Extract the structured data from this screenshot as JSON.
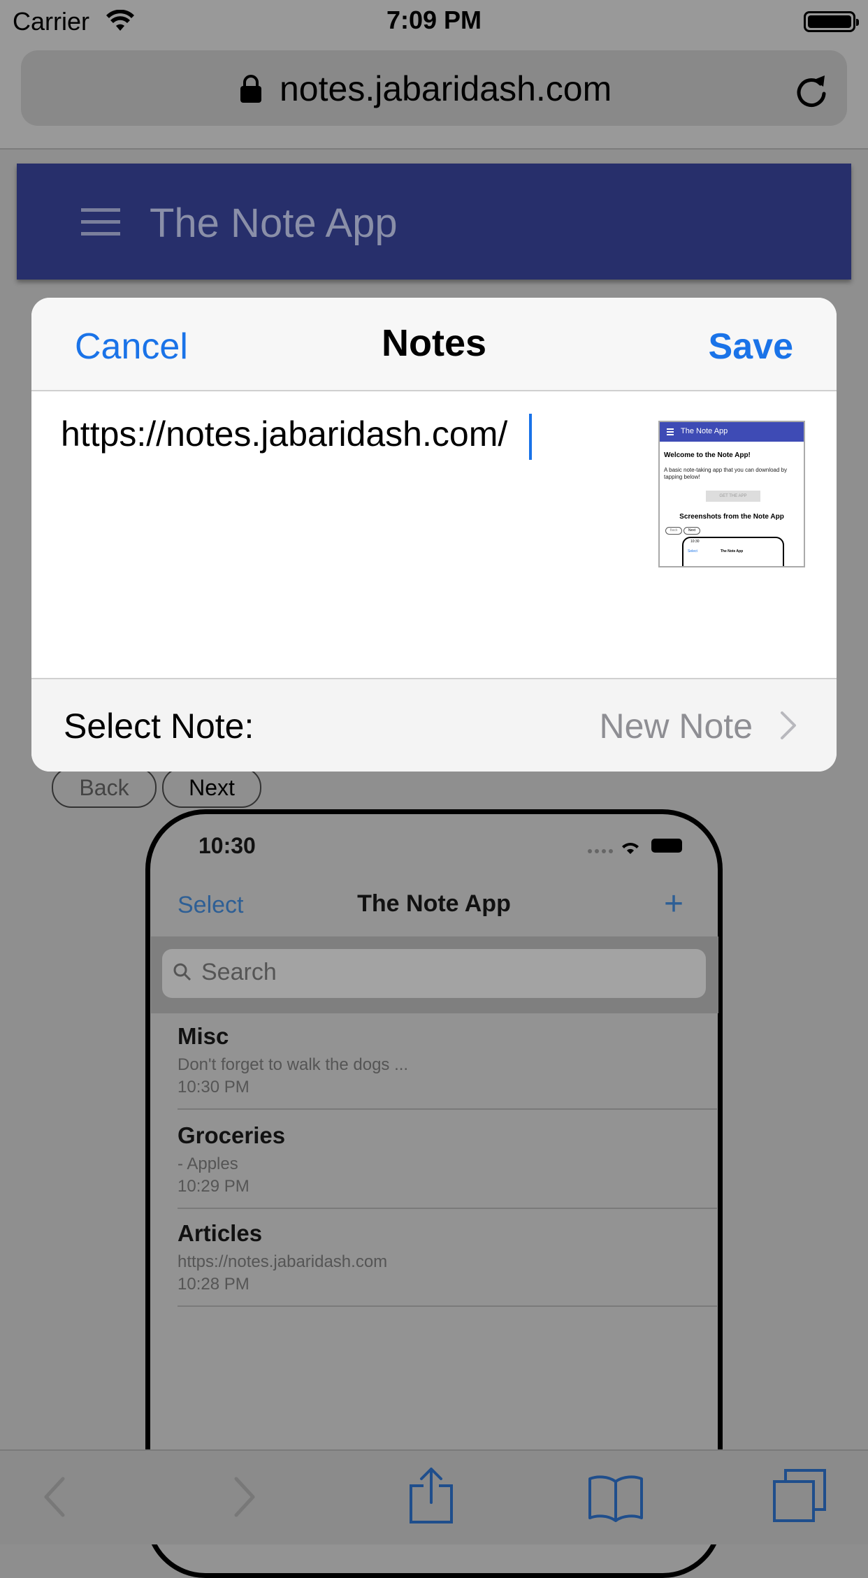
{
  "status_bar": {
    "carrier": "Carrier",
    "time": "7:09 PM"
  },
  "browser": {
    "url": "notes.jabaridash.com"
  },
  "page": {
    "app_title": "The Note App",
    "back_label": "Back",
    "next_label": "Next",
    "mockup": {
      "time": "10:30",
      "select_label": "Select",
      "title": "The Note App",
      "plus": "+",
      "search_placeholder": "Search",
      "notes": [
        {
          "title": "Misc",
          "preview": "Don't forget to walk the dogs ...",
          "time": "10:30 PM"
        },
        {
          "title": "Groceries",
          "preview": "- Apples",
          "time": "10:29 PM"
        },
        {
          "title": "Articles",
          "preview": "https://notes.jabaridash.com",
          "time": "10:28 PM"
        }
      ]
    }
  },
  "sheet": {
    "cancel_label": "Cancel",
    "title": "Notes",
    "save_label": "Save",
    "note_text": "https://notes.jabaridash.com/",
    "select_note_label": "Select Note:",
    "selected_note": "New Note",
    "thumbnail": {
      "app_title": "The Note App",
      "welcome": "Welcome to the Note App!",
      "description": "A basic note-taking app that you can download by tapping below!",
      "get_app": "GET THE APP",
      "screenshots_heading": "Screenshots from the Note App",
      "back": "Back",
      "next": "Next",
      "time": "10:30",
      "select": "Select",
      "title": "The Note App"
    }
  },
  "colors": {
    "accent": "#1a73e8",
    "app_header": "#272f6b",
    "dim_overlay": "#8f8f8f"
  }
}
